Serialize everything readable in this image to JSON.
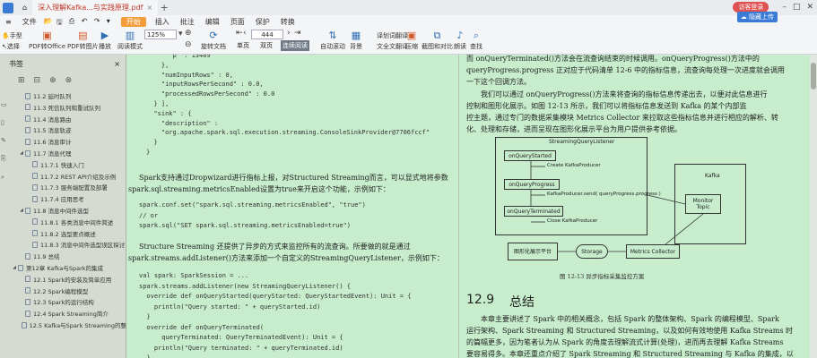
{
  "titlebar": {
    "tab1": "深入理解Kafka...与实践原理.pdf",
    "visitor": "访客登录",
    "cloud": "隐藏上传"
  },
  "menu": {
    "file": "文件",
    "items": [
      "开始",
      "插入",
      "批注",
      "编辑",
      "页面",
      "保护",
      "转换"
    ]
  },
  "toolbar": {
    "tools": [
      "手型",
      "选择",
      "PDF转Office",
      "PDF转图片",
      "播放",
      "阅读模式",
      "旋转文档",
      "单页",
      "双页",
      "连续阅读",
      "自动滚动",
      "背景",
      "全文翻译",
      "压缩",
      "截图和对比",
      "朗读",
      "查找"
    ],
    "zoom": "125%",
    "page": "444",
    "mode_sel": "连续阅读",
    "annot": "划词翻译"
  },
  "sidebar": {
    "title": "书签",
    "items": [
      {
        "label": "11.2 延时队列",
        "indent": 2,
        "hl": false
      },
      {
        "label": "11.3 死信队列和重试队列",
        "indent": 2,
        "hl": false
      },
      {
        "label": "11.4 消息路由",
        "indent": 2,
        "hl": false
      },
      {
        "label": "11.5 消息轨迹",
        "indent": 2,
        "hl": false
      },
      {
        "label": "11.6 消息审计",
        "indent": 2,
        "hl": false
      },
      {
        "label": "11.7 消息代理",
        "indent": 2,
        "hl": false,
        "toggle": "◢"
      },
      {
        "label": "11.7.1 快速入门",
        "indent": 3,
        "hl": false
      },
      {
        "label": "11.7.2 REST API介绍及示例",
        "indent": 3,
        "hl": false
      },
      {
        "label": "11.7.3 服务端配置及部署",
        "indent": 3,
        "hl": false
      },
      {
        "label": "11.7.4 应用思考",
        "indent": 3,
        "hl": false
      },
      {
        "label": "11.8 消息中间件选型",
        "indent": 2,
        "hl": false,
        "toggle": "◢"
      },
      {
        "label": "11.8.1 各类消息中间件简述",
        "indent": 3,
        "hl": false
      },
      {
        "label": "11.8.2 选型要点概述",
        "indent": 3,
        "hl": false
      },
      {
        "label": "11.8.3 消息中间件选型误区探讨",
        "indent": 3,
        "hl": false
      },
      {
        "label": "11.9 总结",
        "indent": 2,
        "hl": false
      },
      {
        "label": "第12章 Kafka与Spark的集成",
        "indent": 1,
        "hl": false,
        "toggle": "◢"
      },
      {
        "label": "12.1 Spark的安装及简单应用",
        "indent": 2,
        "hl": false
      },
      {
        "label": "12.2 Spark编程模型",
        "indent": 2,
        "hl": false
      },
      {
        "label": "12.3 Spark的运行结构",
        "indent": 2,
        "hl": false
      },
      {
        "label": "12.4 Spark Streaming简介",
        "indent": 2,
        "hl": false
      },
      {
        "label": "12.5 Kafka与Spark Streaming的整",
        "indent": 2,
        "hl": false
      }
    ]
  },
  "left_page": {
    "code1": [
      "      \"p\" : 13409",
      "    },",
      "    \"numInputRows\" : 0,",
      "    \"inputRowsPerSecond\" : 0.0,",
      "    \"processedRowsPerSecond\" : 0.0",
      "  } ],",
      "  \"sink\" : {",
      "    \"description\" :",
      "    \"org.apache.spark.sql.execution.streaming.ConsoleSinkProvider@7706fccf\"",
      "  }",
      "}"
    ],
    "para1": "Spark支持通过Dropwizard进行指标上报，对Structured Streaming而言，可以显式地将参数",
    "para1b": "spark.sql.streaming.metricsEnabled设置为true来开启这个功能，示例如下：",
    "code2": [
      "spark.conf.set(\"spark.sql.streaming.metricsEnabled\", \"true\")",
      "// or",
      "spark.sql(\"SET spark.sql.streaming.metricsEnabled=true\")"
    ],
    "para2": "Structure  Streaming  还提供了异步的方式来监控所有的流查询。所要做的就是通过",
    "para2b": "spark.streams.addListener()方法来添加一个自定义的StreamingQueryListener，示例如下：",
    "code3": [
      "val spark: SparkSession = ...",
      "spark.streams.addListener(new StreamingQueryListener() {",
      "  override def onQueryStarted(queryStarted: QueryStartedEvent): Unit = {",
      "    println(\"Query started: \" + queryStarted.id)",
      "  }",
      "  override def onQueryTerminated(",
      "      queryTerminated: QueryTerminatedEvent): Unit = {",
      "    println(\"Query terminated: \" + queryTerminated.id)",
      "  }"
    ]
  },
  "right_page": {
    "para1": [
      "而 onQueryTerminated()方法会在流查询结束的时候调用。onQueryProgress()方法中的",
      "queryProgress.progress 正对应于代码清单 12-6 中的指标信息，流查询每处理一次进度就会调用",
      "一下这个回调方法。"
    ],
    "para2": [
      "我们可以通过 onQueryProgress()方法来将查询的指标信息传递出去，以便对此信息进行",
      "控制和图形化展示。如图 12-13 所示，我们可以将指标信息发送到 Kafka 的某个内部监",
      "控主题，通过专门的数据采集模块 Metrics Collector 来拉取这些指标信息并进行相应的解析、转",
      "化、处理和存储，进而呈现在图形化展示平台为用户提供参考依据。"
    ],
    "diagram": {
      "listener": "StreamingQueryListener",
      "b1": "onQueryStarted",
      "l1": "Create KafkaProducer",
      "b2": "onQueryProgress",
      "l2": "KafkaProducer.send( queryProgress.progress )",
      "b3": "onQueryTerminated",
      "l3": "Close KafkaProducer",
      "kafka": "Kafka",
      "monitor": "Monitor Topic",
      "collector": "Metrics Collector",
      "storage": "Storage",
      "viz": "图形化展示平台"
    },
    "caption": "图 12-13    异步指标采集监控方案",
    "heading_num": "12.9",
    "heading": "总结",
    "para3": [
      "本章主要讲述了 Spark 中的相关概念，包括 Spark 的整体架构、Spark 的编程模型、Spark",
      "运行架构、Spark Streaming 和 Structured Streaming，以及如何有效地使用 Kafka Streams 时",
      "的篇幅更多，因为笔者认为从 Spark 的角度去理解流式计算(处理)，进而再去理解 Kafka Streams",
      "要容易得多。本章还重点介绍了 Spark Streaming 和 Structured Streaming 与 Kafka 的集成，以"
    ]
  }
}
